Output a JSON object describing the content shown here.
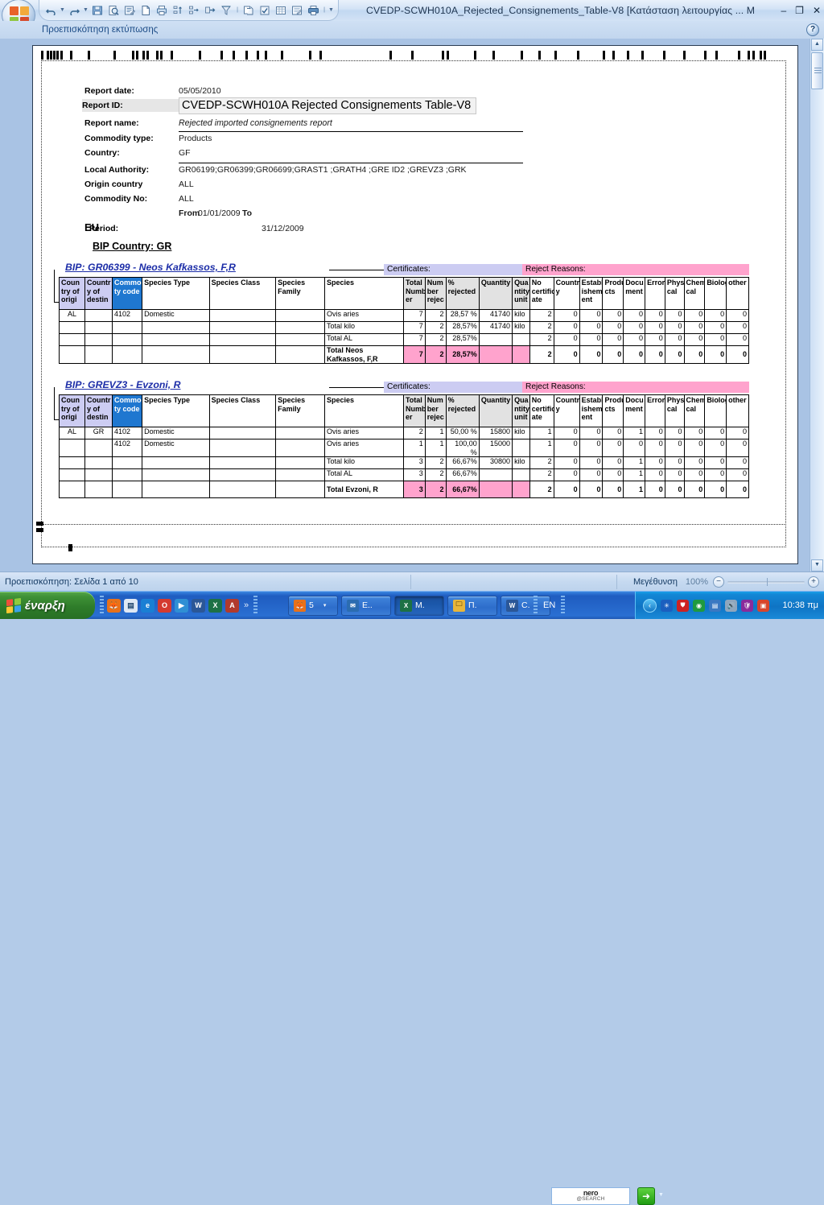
{
  "window": {
    "title": "CVEDP-SCWH010A_Rejected_Consignements_Table-V8  [Κατάσταση λειτουργίας ... M",
    "minimize": "–",
    "restore": "❐",
    "close": "✕",
    "ribbon_label": "Προεπισκόπηση εκτύπωσης",
    "help_label": "?"
  },
  "quick_access": {
    "items": [
      {
        "name": "undo-icon",
        "glyph": "↺"
      },
      {
        "name": "undo-dropdown-icon",
        "glyph": "▾"
      },
      {
        "name": "redo-icon",
        "glyph": "↻"
      },
      {
        "name": "redo-dropdown-icon",
        "glyph": "▾"
      },
      {
        "name": "save-icon",
        "glyph": "💾"
      },
      {
        "name": "print-preview-icon",
        "glyph": "🔍"
      },
      {
        "name": "properties-icon",
        "glyph": "📝"
      },
      {
        "name": "new-document-icon",
        "glyph": "🗋"
      },
      {
        "name": "print-icon",
        "glyph": "🖶"
      },
      {
        "name": "sort-asc-icon",
        "glyph": "⇅"
      },
      {
        "name": "indent-icon",
        "glyph": "⇥"
      },
      {
        "name": "export-icon",
        "glyph": "➔"
      },
      {
        "name": "filter-icon",
        "glyph": "⊻"
      },
      {
        "name": "copy-icon",
        "glyph": "🗐"
      },
      {
        "name": "checkbox-icon",
        "glyph": "☑"
      },
      {
        "name": "table-icon",
        "glyph": "▦"
      },
      {
        "name": "report-icon",
        "glyph": "🗒"
      },
      {
        "name": "quick-print-icon",
        "glyph": "🖨"
      },
      {
        "name": "customize-qat-icon",
        "glyph": "▾"
      }
    ]
  },
  "report": {
    "fields": [
      {
        "label": "Report date:",
        "value": "05/05/2010"
      },
      {
        "label": "Report ID:",
        "value": "CVEDP-SCWH010A Rejected Consignements Table-V8"
      },
      {
        "label": "Report name:",
        "value": "Rejected imported consignements report"
      },
      {
        "label": "Commodity type:",
        "value": "Products"
      },
      {
        "label": "Country:",
        "value": "GF"
      },
      {
        "label": "Local Authority:",
        "value": "GR06199;GR06399;GR06699;GRAST1 ;GRATH4 ;GRE ID2 ;GREVZ3 ;GRK"
      },
      {
        "label": "Origin country",
        "value": "ALL"
      },
      {
        "label": "Commodity No:",
        "value": "ALL"
      },
      {
        "label": "",
        "value": "From 01/01/2009  To",
        "from_label": "From",
        "from_value": "01/01/2009",
        "to_label": "To"
      },
      {
        "label": "Period:",
        "value": "31/12/2009"
      }
    ],
    "region": "EU",
    "bip_country": "BIP Country: GR",
    "band_certificates": "Certificates:",
    "band_reject_reasons": "Reject Reasons:",
    "columns": [
      "Coun try of origi",
      "Countr y of destin",
      "Commodi ty code",
      "Species Type",
      "Species Class",
      "Species Family",
      "Species",
      "Total Numb er",
      "Num ber rejec",
      "% rejected",
      "Quantity",
      "Qua ntity unit",
      "No certific ate",
      "Countr y",
      "Establ ishem ent",
      "Produ cts",
      "Docu ment",
      "Error",
      "Physi cal",
      "Chemi cal",
      "Biolog",
      "other"
    ],
    "sections": [
      {
        "bip": "BIP: GR06399 - Neos Kafkassos, F,R",
        "rows": [
          {
            "kind": "data",
            "cells": [
              "AL",
              "",
              "4102",
              "Domestic",
              "",
              "",
              "Ovis aries",
              "7",
              "2",
              "28,57 %",
              "41740",
              "kilo",
              "2",
              "0",
              "0",
              "0",
              "0",
              "0",
              "0",
              "0",
              "0",
              "0"
            ]
          },
          {
            "kind": "total",
            "cells": [
              "",
              "",
              "",
              "",
              "",
              "",
              "Total kilo",
              "7",
              "2",
              "28,57%",
              "41740",
              "kilo",
              "2",
              "0",
              "0",
              "0",
              "0",
              "0",
              "0",
              "0",
              "0",
              "0"
            ]
          },
          {
            "kind": "total",
            "cells": [
              "",
              "",
              "",
              "",
              "",
              "",
              "Total AL",
              "7",
              "2",
              "28,57%",
              "",
              "",
              "2",
              "0",
              "0",
              "0",
              "0",
              "0",
              "0",
              "0",
              "0",
              "0"
            ]
          },
          {
            "kind": "grand",
            "cells": [
              "",
              "",
              "",
              "",
              "",
              "",
              "Total Neos Kafkassos, F,R",
              "7",
              "2",
              "28,57%",
              "",
              "",
              "2",
              "0",
              "0",
              "0",
              "0",
              "0",
              "0",
              "0",
              "0",
              "0"
            ]
          }
        ]
      },
      {
        "bip": "BIP: GREVZ3 - Evzoni,  R",
        "rows": [
          {
            "kind": "data",
            "cells": [
              "AL",
              "GR",
              "4102",
              "Domestic",
              "",
              "",
              "Ovis aries",
              "2",
              "1",
              "50,00 %",
              "15800",
              "kilo",
              "1",
              "0",
              "0",
              "0",
              "1",
              "0",
              "0",
              "0",
              "0",
              "0"
            ]
          },
          {
            "kind": "data",
            "cells": [
              "",
              "",
              "4102",
              "Domestic",
              "",
              "",
              "Ovis aries",
              "1",
              "1",
              "100,00 %",
              "15000",
              "",
              "1",
              "0",
              "0",
              "0",
              "0",
              "0",
              "0",
              "0",
              "0",
              "0"
            ]
          },
          {
            "kind": "total",
            "cells": [
              "",
              "",
              "",
              "",
              "",
              "",
              "Total kilo",
              "3",
              "2",
              "66,67%",
              "30800",
              "kilo",
              "2",
              "0",
              "0",
              "0",
              "1",
              "0",
              "0",
              "0",
              "0",
              "0"
            ]
          },
          {
            "kind": "total",
            "cells": [
              "",
              "",
              "",
              "",
              "",
              "",
              "Total AL",
              "3",
              "2",
              "66,67%",
              "",
              "",
              "2",
              "0",
              "0",
              "0",
              "1",
              "0",
              "0",
              "0",
              "0",
              "0"
            ]
          },
          {
            "kind": "grand",
            "cells": [
              "",
              "",
              "",
              "",
              "",
              "",
              "Total Evzoni,  R",
              "3",
              "2",
              "66,67%",
              "",
              "",
              "2",
              "0",
              "0",
              "0",
              "1",
              "0",
              "0",
              "0",
              "0",
              "0"
            ]
          }
        ]
      }
    ]
  },
  "statusbar": {
    "page_status": "Προεπισκόπηση: Σελίδα 1 από 10",
    "zoom_label": "Μεγέθυνση",
    "zoom_value": "100%",
    "zoom_out": "−",
    "zoom_in": "+"
  },
  "taskbar": {
    "start_label": "έναρξη",
    "quick_launch": [
      {
        "name": "firefox-icon",
        "glyph": "🦊",
        "color": "#e8711a"
      },
      {
        "name": "notepad-icon",
        "glyph": "📄",
        "color": "#dfe8f4"
      },
      {
        "name": "internet-explorer-icon",
        "glyph": "e",
        "color": "#1a7fd4"
      },
      {
        "name": "opera-icon",
        "glyph": "O",
        "color": "#d43a2f"
      },
      {
        "name": "media-player-icon",
        "glyph": "▶",
        "color": "#2f8fd4"
      },
      {
        "name": "word-icon",
        "glyph": "W",
        "color": "#2b5797"
      },
      {
        "name": "excel-icon",
        "glyph": "X",
        "color": "#1d7145"
      },
      {
        "name": "access-icon",
        "glyph": "A",
        "color": "#b23a2c"
      }
    ],
    "quick_launch_more": "»",
    "tasks": [
      {
        "name": "firefox-task",
        "label": "5",
        "icon": "🦊",
        "color": "#e8711a",
        "active": false,
        "dropdown": "▾"
      },
      {
        "name": "outlook-task",
        "label": "E..",
        "icon": "✉",
        "color": "#2b6cb0",
        "active": false
      },
      {
        "name": "excel-task",
        "label": "M.",
        "icon": "X",
        "color": "#1d7145",
        "active": true
      },
      {
        "name": "explorer-task",
        "label": "Π.",
        "icon": "🗀",
        "color": "#e8b63a",
        "active": false
      },
      {
        "name": "word-task",
        "label": "C.",
        "icon": "W",
        "color": "#2b5797",
        "active": false
      }
    ],
    "language": "EN",
    "nero_top": "nero",
    "nero_bottom": "@SEARCH",
    "tray": [
      {
        "name": "show-hidden-icons",
        "glyph": "‹"
      },
      {
        "name": "bluetooth-icon",
        "glyph": "✳",
        "color": "#1b5fbf"
      },
      {
        "name": "safety-icon",
        "glyph": "⛊",
        "color": "#cc2222"
      },
      {
        "name": "disc-icon",
        "glyph": "◉",
        "color": "#1f9a3f"
      },
      {
        "name": "network-icon",
        "glyph": "🖧",
        "color": "#3a78c2"
      },
      {
        "name": "volume-icon",
        "glyph": "🔊",
        "color": "#8fa6bd"
      },
      {
        "name": "antivirus-icon",
        "glyph": "🛡",
        "color": "#8a2b9b"
      },
      {
        "name": "display-icon",
        "glyph": "🖥",
        "color": "#d8452b"
      }
    ],
    "clock": "10:38 πμ"
  }
}
